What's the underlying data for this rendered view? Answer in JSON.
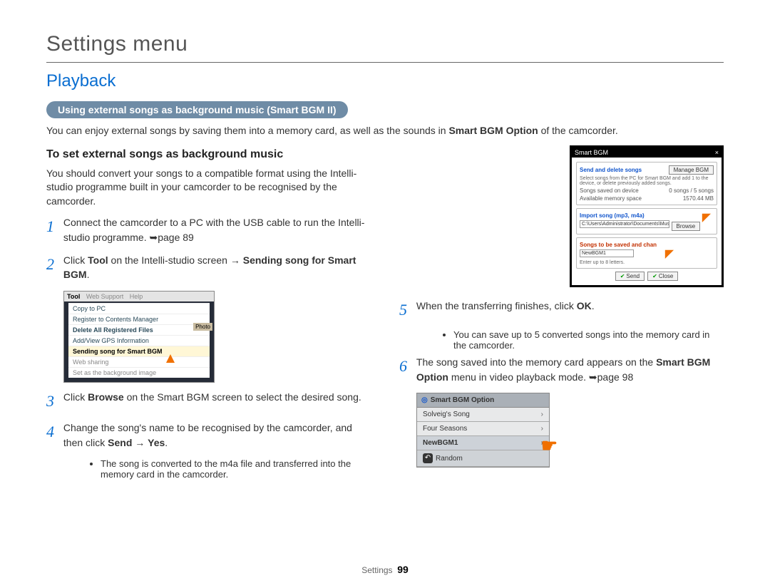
{
  "breadcrumb": "Settings menu",
  "section_title": "Playback",
  "pill_label": "Using external songs as background music (Smart BGM II)",
  "intro_pre": "You can enjoy external songs by saving them into a memory card, as well as the sounds in ",
  "intro_bold": "Smart BGM Option",
  "intro_post": " of the camcorder.",
  "sub_heading": "To set external songs as background music",
  "convert_note": "You should convert your songs to a compatible format using the Intelli-studio programme built in your camcorder to be recognised by the camcorder.",
  "steps": {
    "s1": {
      "num": "1",
      "text": "Connect the camcorder to a PC with the USB cable to run the Intelli-studio programme. ➥page 89"
    },
    "s2": {
      "num": "2",
      "pre": "Click ",
      "b1": "Tool",
      "mid": " on the Intelli-studio screen → ",
      "b2": "Sending song for Smart BGM",
      "post": "."
    },
    "s3": {
      "num": "3",
      "pre": "Click ",
      "b1": "Browse",
      "post": " on the Smart BGM screen to select the desired song."
    },
    "s4": {
      "num": "4",
      "pre": "Change the song's name to be recognised by the camcorder, and then click ",
      "b1": "Send",
      "mid": " → ",
      "b2": "Yes",
      "post": "."
    },
    "s4_bullet": "The song is converted to the m4a file and transferred into the memory card in the camcorder.",
    "s5": {
      "num": "5",
      "pre": "When the transferring finishes, click ",
      "b1": "OK",
      "post": "."
    },
    "s5_bullet": "You can save up to 5 converted songs into the memory card in the camcorder.",
    "s6": {
      "num": "6",
      "pre": "The song saved into the memory card appears on the ",
      "b1": "Smart BGM Option",
      "post": " menu in video playback mode. ➥page 98"
    }
  },
  "shot1": {
    "menubar": [
      "Tool",
      "Web Support",
      "Help"
    ],
    "items": [
      "Copy to PC",
      "Register to Contents Manager",
      "Delete All Registered Files",
      "Add/View GPS Information",
      "Sending song for Smart BGM",
      "Web sharing",
      "Set as the background image"
    ],
    "side_tag": "Photo"
  },
  "shot2": {
    "title": "Smart BGM",
    "manage": "Manage BGM",
    "heading1": "Send and delete songs",
    "sub1": "Select songs from the PC for Smart BGM and add 1 to the device, or delete previously added songs.",
    "row_saved_l": "Songs saved on device",
    "row_saved_v": "0 songs / 5 songs",
    "row_mem_l": "Available memory space",
    "row_mem_v": "1570.44 MB",
    "heading2": "Import song (mp3, m4a)",
    "path": "C:\\Users\\Administrator\\Documents\\Music",
    "browse": "Browse",
    "heading3": "Songs to be saved and chan",
    "newname": "NewBGM1",
    "limit": "Enter up to 8 letters.",
    "send": "Send",
    "close": "Close"
  },
  "shot3": {
    "title": "Smart BGM Option",
    "items": [
      "Solveig's Song",
      "Four Seasons",
      "NewBGM1",
      "Random"
    ],
    "back": "↶"
  },
  "footer_label": "Settings",
  "footer_page": "99"
}
